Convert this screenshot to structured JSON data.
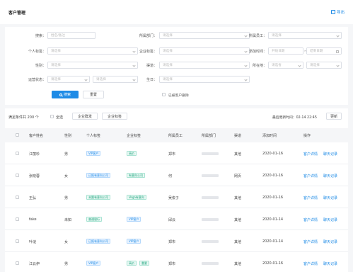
{
  "header": {
    "title": "客户管理",
    "export_label": "导出"
  },
  "filters": {
    "labels": [
      "搜索：",
      "所属部门：",
      "所属员工：",
      "个人标签：",
      "企业标签：",
      "添加时间：",
      "性别：",
      "渠道：",
      "所在地：",
      "运营状态：",
      "生日："
    ],
    "search_placeholder": "姓名/备注",
    "select_placeholder": "请选择",
    "start_date": "开始日期",
    "end_date": "结束日期",
    "date_sep": "～",
    "province": "请选省",
    "city": "请选择",
    "search_button": "搜索",
    "reset_button": "重置",
    "deleted_checkbox": "已被客户删除"
  },
  "toolbar": {
    "selected_count": "满足条件共 200 个",
    "select_all": "全选",
    "tag_button_1": "企业群发",
    "tag_button_2": "企业标签",
    "last_update": "最后更新时间：02-14 22:45",
    "refresh_button": "更新"
  },
  "table": {
    "headers": [
      "客户姓名",
      "性别",
      "个人标签",
      "企业标签",
      "所属员工",
      "所属部门",
      "渠道",
      "添加时间",
      "操作"
    ],
    "rows": [
      {
        "name": "江丽珍",
        "gender": "男",
        "ptags": [
          "VIP客户"
        ],
        "etags": [
          "高价"
        ],
        "staff": "郑市",
        "channel": "其他",
        "date": "2020-01-16",
        "ops": [
          "客户详情",
          "聊天记录"
        ]
      },
      {
        "name": "张晓蓉",
        "gender": "女",
        "ptags": [
          "已报有意向公司"
        ],
        "etags": [
          "有意向公司"
        ],
        "staff": "何",
        "channel": "网页",
        "date": "2020-01-16",
        "ops": [
          "客户详情",
          "聊天记录"
        ]
      },
      {
        "name": "王弘",
        "gender": "男",
        "ptags": [
          "未跟有意向公司"
        ],
        "etags": [
          "Vega有意向"
        ],
        "staff": "吴俊子",
        "channel": "其他",
        "date": "2020-01-16",
        "ops": [
          "客户详情",
          "聊天记录"
        ]
      },
      {
        "name": "fake",
        "gender": "未知",
        "ptags": [
          "普通银行"
        ],
        "etags": [
          "VIP客户"
        ],
        "staff": "邱云",
        "channel": "其他",
        "date": "2020-01-14",
        "ops": [
          "客户详情",
          "聊天记录"
        ]
      },
      {
        "name": "叶谜",
        "gender": "女",
        "ptags": [
          "已报有意向公司"
        ],
        "etags": [
          "VIP客户"
        ],
        "staff": "郑市",
        "channel": "其他",
        "date": "2020-01-14",
        "ops": [
          "客户详情",
          "聊天记录"
        ]
      },
      {
        "name": "江云伊",
        "gender": "男",
        "ptags": [
          "VIP客户"
        ],
        "etags": [
          "高价",
          "重要"
        ],
        "staff": "郑市",
        "channel": "其他",
        "date": "2020-01-16",
        "ops": [
          "客户详情",
          "聊天记录"
        ]
      }
    ]
  },
  "colors": {
    "accent": "#1e8be6",
    "tag_green": "#1aa37a"
  }
}
